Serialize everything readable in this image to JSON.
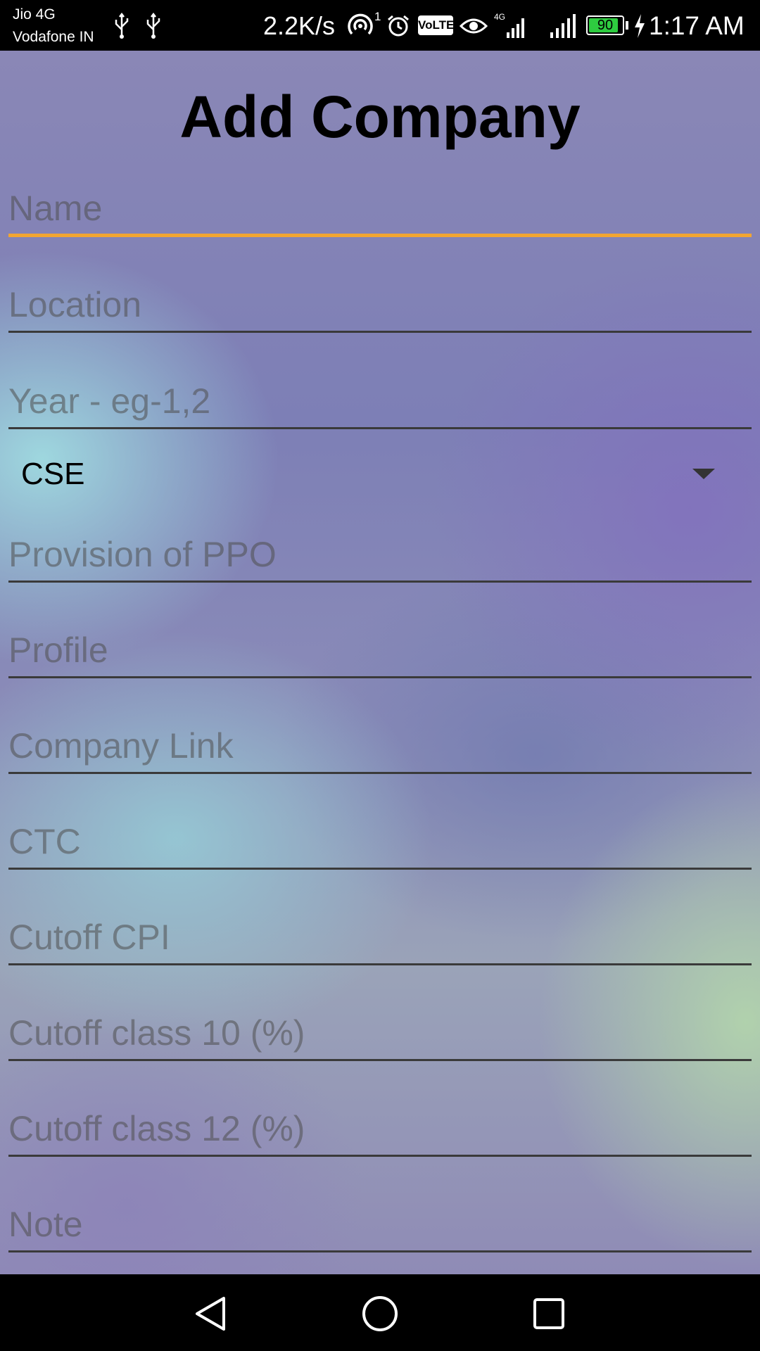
{
  "status_bar": {
    "carrier_1": "Jio 4G",
    "carrier_2": "Vodafone IN",
    "net_speed": "2.2K/s",
    "hotspot_count": "1",
    "volte": "VoLTE",
    "lte": "4G",
    "battery_level": "90",
    "battery_percent": 90,
    "time": "1:17 AM",
    "icons": [
      "usb-icon",
      "usb-icon",
      "hotspot-icon",
      "alarm-icon",
      "volte-icon",
      "eye-icon",
      "lte-signal-icon",
      "signal-icon",
      "battery-icon",
      "charging-icon"
    ]
  },
  "form": {
    "title": "Add Company",
    "fields": {
      "name": {
        "placeholder": "Name",
        "value": ""
      },
      "location": {
        "placeholder": "Location",
        "value": ""
      },
      "year": {
        "placeholder": "Year - eg-1,2",
        "value": ""
      },
      "ppo": {
        "placeholder": "Provision of PPO",
        "value": ""
      },
      "profile": {
        "placeholder": "Profile",
        "value": ""
      },
      "company_link": {
        "placeholder": "Company Link",
        "value": ""
      },
      "ctc": {
        "placeholder": "CTC",
        "value": ""
      },
      "cutoff_cpi": {
        "placeholder": "Cutoff CPI",
        "value": ""
      },
      "cutoff_10": {
        "placeholder": "Cutoff class 10 (%)",
        "value": ""
      },
      "cutoff_12": {
        "placeholder": "Cutoff class 12 (%)",
        "value": ""
      },
      "note": {
        "placeholder": "Note",
        "value": ""
      }
    },
    "branch_spinner": {
      "selected": "CSE"
    },
    "focused_field": "name"
  },
  "colors": {
    "focus_underline": "#f2a531",
    "underline": "#3a3a3a",
    "battery_fill": "#2ecc40"
  },
  "nav_bar": {
    "icons": [
      "back-icon",
      "home-icon",
      "recents-icon"
    ]
  }
}
